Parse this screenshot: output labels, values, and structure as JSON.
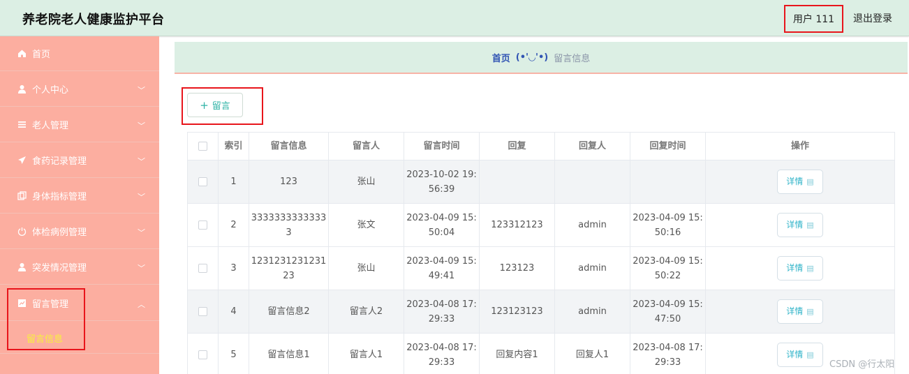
{
  "app": {
    "title": "养老院老人健康监护平台",
    "user_label": "用户 111",
    "logout_label": "退出登录"
  },
  "sidebar": {
    "items": [
      {
        "label": "首页",
        "icon": "home-icon",
        "expandable": false
      },
      {
        "label": "个人中心",
        "icon": "user-icon",
        "expandable": true
      },
      {
        "label": "老人管理",
        "icon": "list-icon",
        "expandable": true
      },
      {
        "label": "食药记录管理",
        "icon": "send-icon",
        "expandable": true
      },
      {
        "label": "身体指标管理",
        "icon": "copy-icon",
        "expandable": true
      },
      {
        "label": "体检病例管理",
        "icon": "power-icon",
        "expandable": true
      },
      {
        "label": "突发情况管理",
        "icon": "user-icon",
        "expandable": true
      },
      {
        "label": "留言管理",
        "icon": "chart-icon",
        "expandable": true,
        "expanded": true
      }
    ],
    "sub_item": "留言信息"
  },
  "breadcrumb": {
    "home": "首页",
    "separator": "(•'◡'•)",
    "current": "留言信息"
  },
  "toolbar": {
    "add_label": "留言",
    "add_icon": "plus-icon"
  },
  "table": {
    "columns": [
      "",
      "索引",
      "留言信息",
      "留言人",
      "留言时间",
      "回复",
      "回复人",
      "回复时间",
      "操作"
    ],
    "detail_label": "详情",
    "rows": [
      {
        "index": "1",
        "message": "123",
        "author": "张山",
        "time": "2023-10-02 19:56:39",
        "reply": "",
        "replier": "",
        "reply_time": ""
      },
      {
        "index": "2",
        "message": "33333333333333",
        "author": "张文",
        "time": "2023-04-09 15:50:04",
        "reply": "123312123",
        "replier": "admin",
        "reply_time": "2023-04-09 15:50:16"
      },
      {
        "index": "3",
        "message": "123123123123123",
        "author": "张山",
        "time": "2023-04-09 15:49:41",
        "reply": "123123",
        "replier": "admin",
        "reply_time": "2023-04-09 15:50:22"
      },
      {
        "index": "4",
        "message": "留言信息2",
        "author": "留言人2",
        "time": "2023-04-08 17:29:33",
        "reply": "123123123",
        "replier": "admin",
        "reply_time": "2023-04-09 15:47:50"
      },
      {
        "index": "5",
        "message": "留言信息1",
        "author": "留言人1",
        "time": "2023-04-08 17:29:33",
        "reply": "回复内容1",
        "replier": "回复人1",
        "reply_time": "2023-04-08 17:29:33"
      }
    ]
  },
  "watermark": "CSDN @行太阳",
  "colors": {
    "header_bg": "#dcefe4",
    "sidebar_bg": "#fcaea0",
    "active_sub": "#f7f23b",
    "accent": "#2fb3a6",
    "highlight_box": "#e8151b"
  }
}
